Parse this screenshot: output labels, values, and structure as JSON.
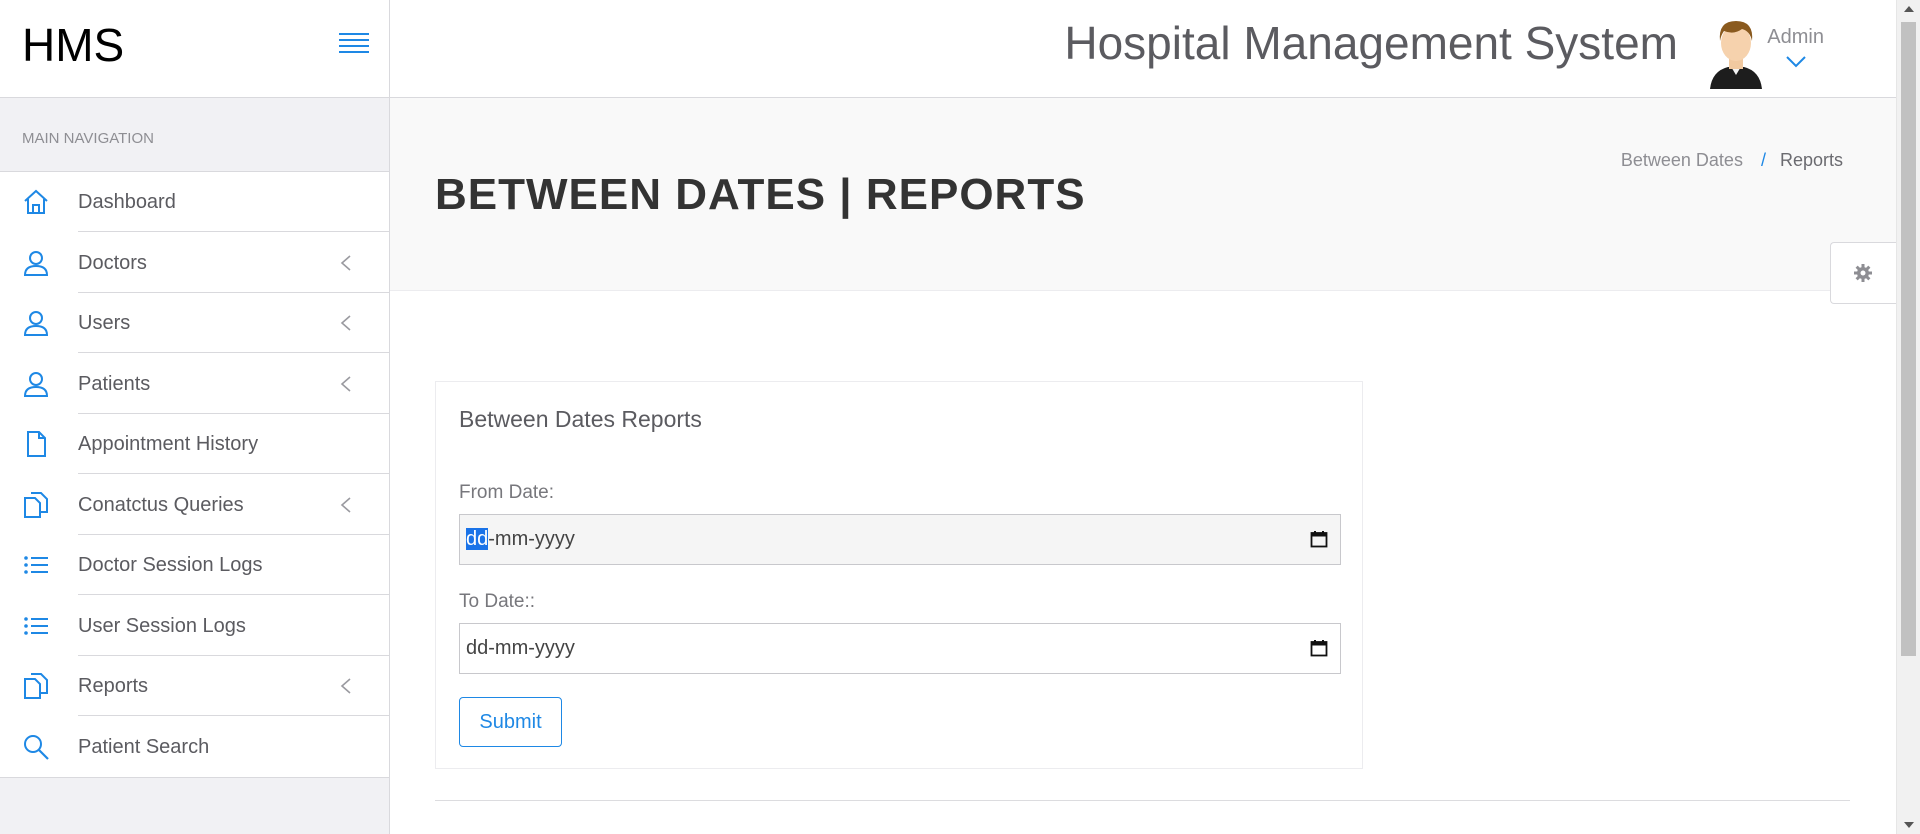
{
  "brand": "HMS",
  "header": {
    "app_title": "Hospital Management System",
    "user_label": "Admin"
  },
  "sidebar": {
    "heading": "MAIN NAVIGATION",
    "items": [
      {
        "label": "Dashboard",
        "icon": "home-icon",
        "has_submenu": false
      },
      {
        "label": "Doctors",
        "icon": "user-icon",
        "has_submenu": true
      },
      {
        "label": "Users",
        "icon": "user-icon",
        "has_submenu": true
      },
      {
        "label": "Patients",
        "icon": "user-icon",
        "has_submenu": true
      },
      {
        "label": "Appointment History",
        "icon": "file-icon",
        "has_submenu": false
      },
      {
        "label": "Conatctus Queries",
        "icon": "files-icon",
        "has_submenu": true
      },
      {
        "label": "Doctor Session Logs",
        "icon": "list-icon",
        "has_submenu": false
      },
      {
        "label": "User Session Logs",
        "icon": "list-icon",
        "has_submenu": false
      },
      {
        "label": "Reports",
        "icon": "files-icon",
        "has_submenu": true
      },
      {
        "label": "Patient Search",
        "icon": "search-icon",
        "has_submenu": false
      }
    ]
  },
  "page": {
    "title": "BETWEEN DATES | REPORTS",
    "breadcrumb": [
      "Between Dates",
      "Reports"
    ]
  },
  "form": {
    "panel_title": "Between Dates Reports",
    "from_label": "From Date:",
    "from_value_selected": "dd",
    "from_value_rest": "-mm-yyyy",
    "to_label": "To Date::",
    "to_value": "dd-mm-yyyy",
    "submit_label": "Submit"
  },
  "colors": {
    "accent": "#1e88e5",
    "selection": "#1a73e8"
  }
}
